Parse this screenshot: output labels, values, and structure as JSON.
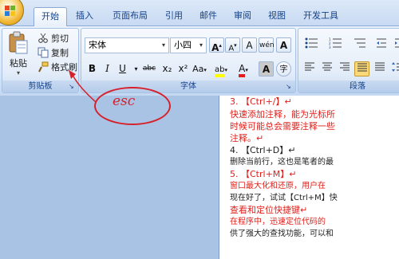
{
  "tabs": [
    "开始",
    "插入",
    "页面布局",
    "引用",
    "邮件",
    "审阅",
    "视图",
    "开发工具"
  ],
  "clipboard": {
    "paste_label": "粘贴",
    "cut_label": "剪切",
    "copy_label": "复制",
    "format_painter_label": "格式刷",
    "group_label": "剪贴板"
  },
  "font": {
    "font_name": "宋体",
    "font_size": "小四",
    "group_label": "字体",
    "grow_font": "A",
    "shrink_font": "A",
    "clear_format": "A",
    "phonetic": "wén",
    "char_border": "A",
    "bold": "B",
    "italic": "I",
    "underline": "U",
    "strikethrough": "abc",
    "subscript": "x₂",
    "superscript": "x²",
    "change_case": "Aa",
    "highlight": "ab",
    "font_color": "A",
    "char_shading": "A",
    "enclose": "字"
  },
  "paragraph": {
    "group_label": "段落"
  },
  "annotation": {
    "text": "esc",
    "color": "#d6212b"
  },
  "document": {
    "lines": [
      {
        "text": "3. 【Ctrl+/】↵",
        "style": "red"
      },
      {
        "text": "快速添加注释，能为光标所",
        "style": "red"
      },
      {
        "text": "时候可能总会需要注释一些",
        "style": "red"
      },
      {
        "text": "注释。↵",
        "style": "red"
      },
      {
        "text": "4. 【Ctrl+D】↵",
        "style": "blk"
      },
      {
        "text": "删除当前行，这也是笔者的最",
        "style": "blk"
      },
      {
        "text": "5. 【Ctrl+M】↵",
        "style": "red"
      },
      {
        "text": "窗口最大化和还原，用户在",
        "style": "red"
      },
      {
        "text": "现在好了，试试【Ctrl+M】快",
        "style": "blk"
      },
      {
        "text": "查看和定位快捷键↵",
        "style": "red"
      },
      {
        "text": "在程序中，迅速定位代码的",
        "style": "red"
      },
      {
        "text": "供了强大的查找功能，可以和",
        "style": "blk"
      }
    ]
  },
  "colors": {
    "ribbon_text": "#15428b",
    "annotation_red": "#d6212b",
    "doc_red": "#e0201b"
  }
}
